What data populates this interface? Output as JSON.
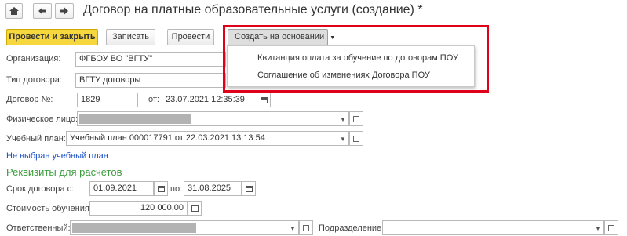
{
  "window": {
    "title": "Договор на платные образовательные услуги (создание) *"
  },
  "nav": {
    "home_icon": "home-icon",
    "back_icon": "arrow-left-icon",
    "forward_icon": "arrow-right-icon"
  },
  "toolbar": {
    "post_close": "Провести и закрыть",
    "save": "Записать",
    "post": "Провести",
    "create_based": "Создать на основании"
  },
  "menu": {
    "items": [
      "Квитанция оплата за обучение по договорам ПОУ",
      "Соглашение об изменениях Договора ПОУ"
    ]
  },
  "form": {
    "organization": {
      "label": "Организация:",
      "value": "ФГБОУ ВО \"ВГТУ\""
    },
    "contract_type": {
      "label": "Тип договора:",
      "value": "ВГТУ договоры"
    },
    "contract_no": {
      "label": "Договор №:",
      "value": "1829",
      "from_label": "от:",
      "date": "23.07.2021 12:35:39"
    },
    "person": {
      "label": "Физическое лицо:"
    },
    "plan": {
      "label": "Учебный план:",
      "value": "Учебный план 000017791 от 22.03.2021 13:13:54"
    },
    "plan_warning": "Не выбран учебный план",
    "section_title": "Реквизиты для расчетов",
    "term": {
      "label": "Срок договора с:",
      "from": "01.09.2021",
      "to_label": "по:",
      "to": "31.08.2025"
    },
    "cost": {
      "label": "Стоимость обучения:",
      "value": "120 000,00"
    },
    "responsible": {
      "label": "Ответственный:"
    },
    "division": {
      "label": "Подразделение:"
    }
  },
  "colors": {
    "primary_button": "#f7d73e",
    "highlight_frame": "#e0001a",
    "section": "#3c9c3c",
    "link": "#1a4fc7"
  }
}
